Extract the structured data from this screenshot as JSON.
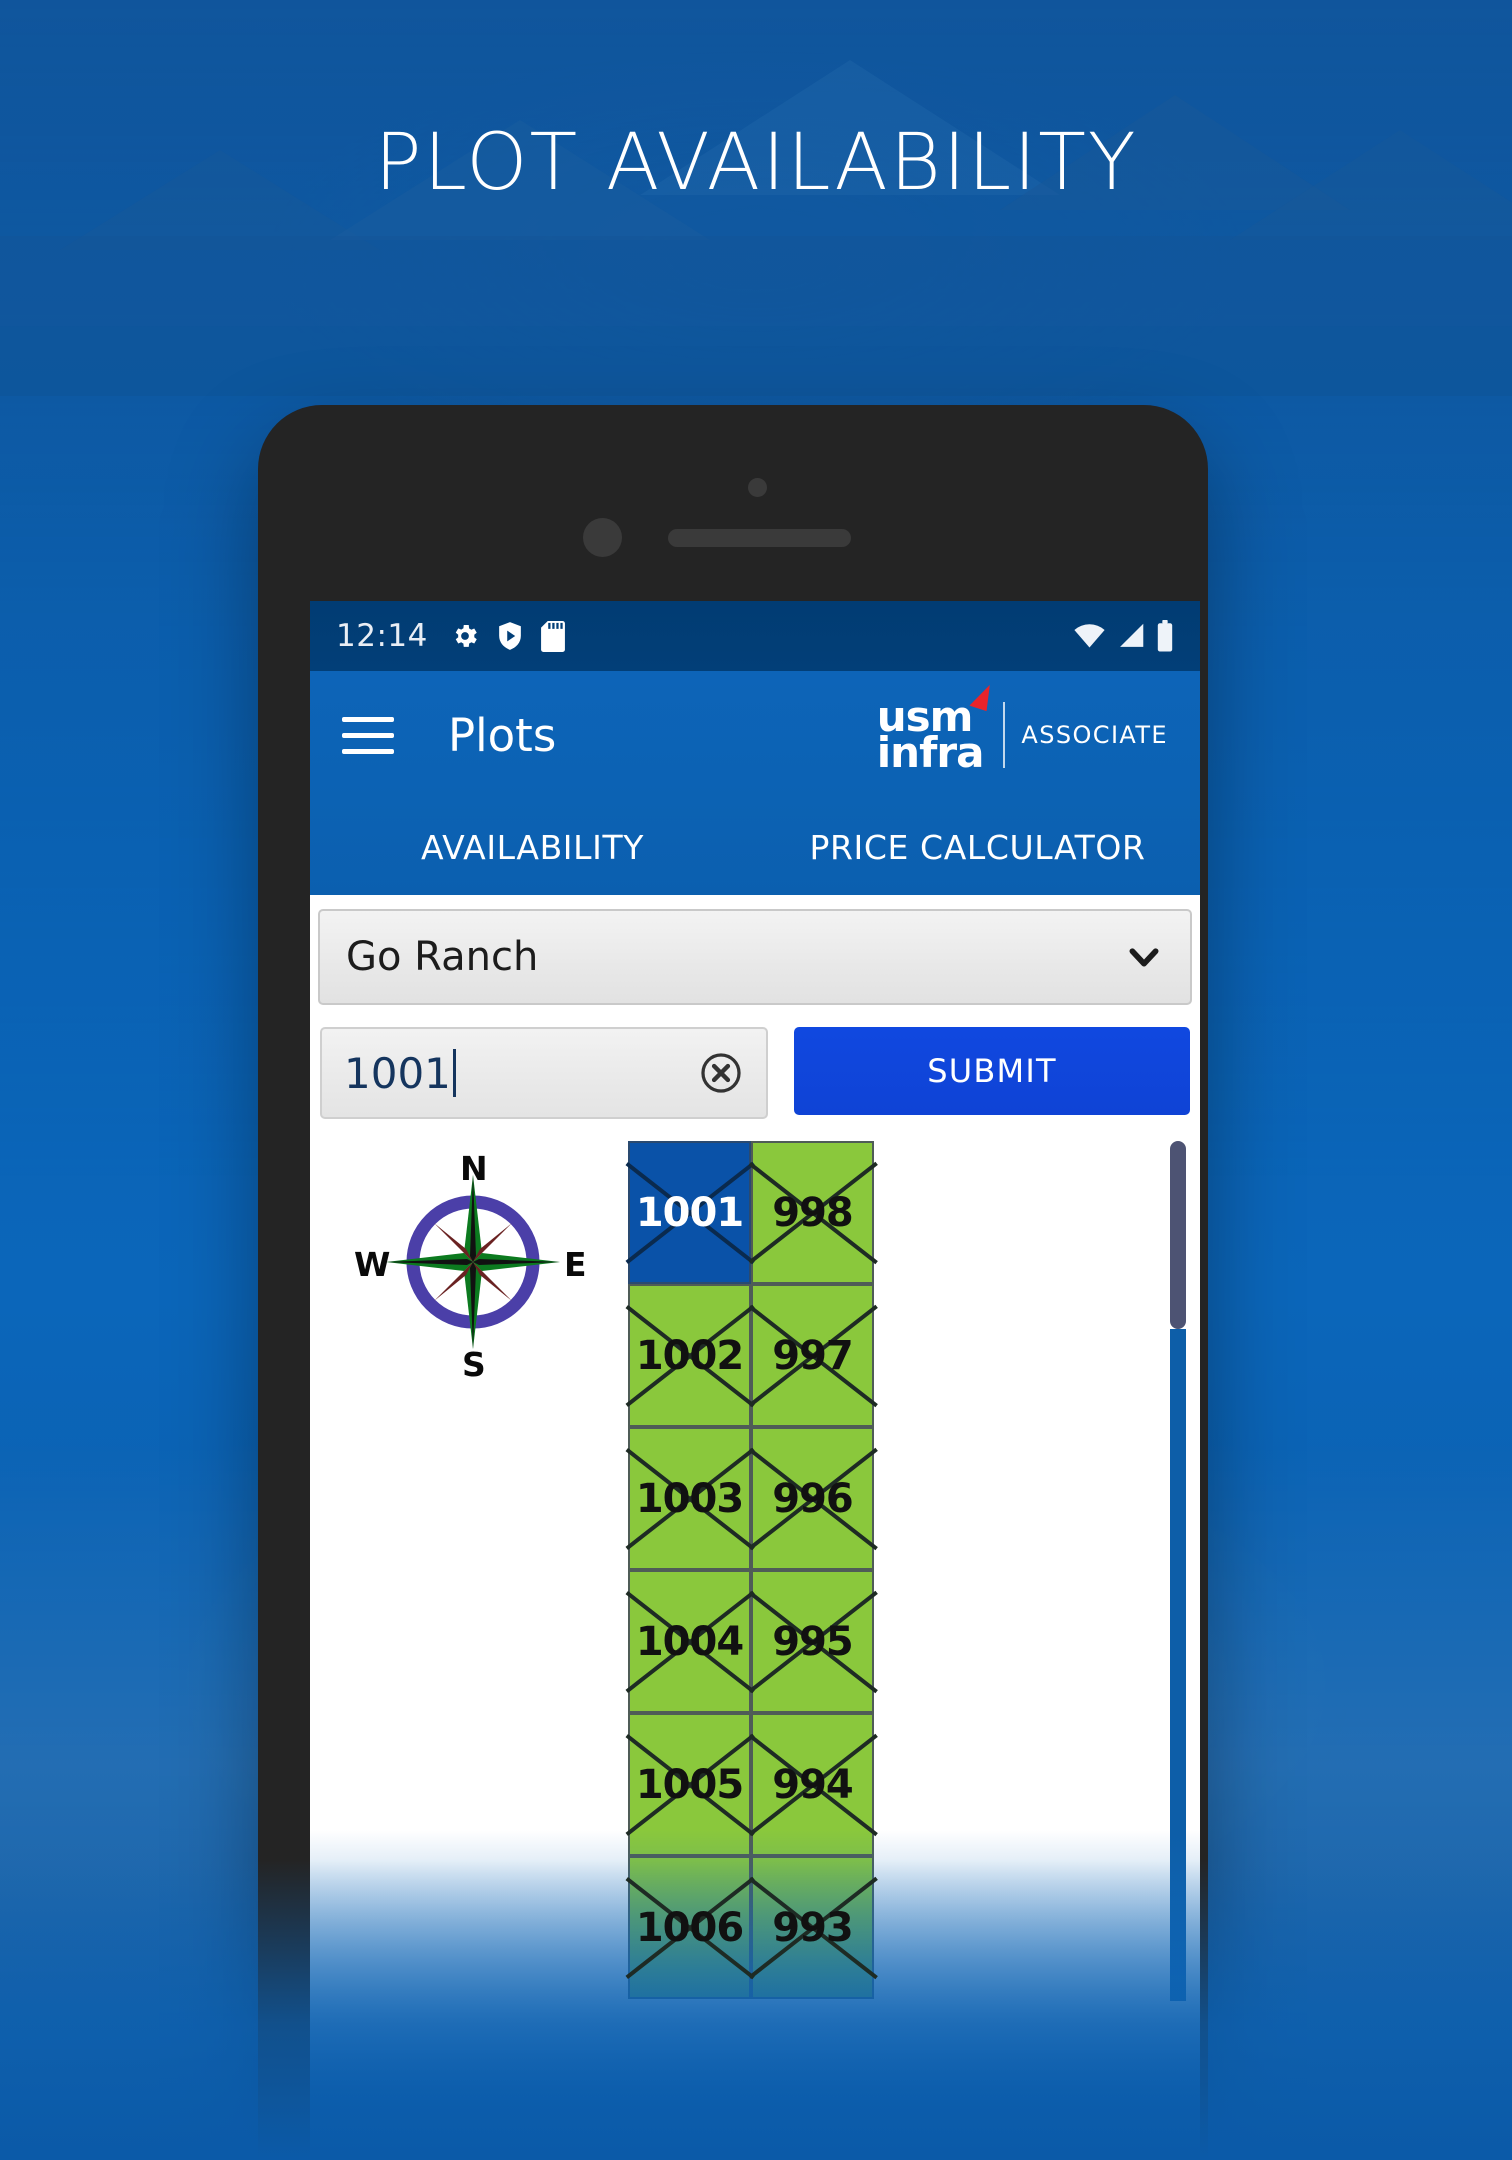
{
  "poster": {
    "title": "PLOT AVAILABILITY",
    "background_color": "#0b62b4",
    "title_color": "#ffffff"
  },
  "statusbar": {
    "time": "12:14",
    "left_icons": [
      "gear-icon",
      "shield-play-icon",
      "sd-card-icon"
    ],
    "right_icons": [
      "wifi-icon",
      "cellular-signal-icon",
      "battery-icon"
    ],
    "background_color": "#023f78"
  },
  "appbar": {
    "menu_icon": "hamburger-menu-icon",
    "title": "Plots",
    "brand": {
      "line1": "usm",
      "line2": "infra",
      "associate": "ASSOCIATE",
      "mark_color": "#e8242a"
    },
    "background_color": "#0c62b3"
  },
  "tabs": [
    {
      "label": "AVAILABILITY",
      "selected": true
    },
    {
      "label": "PRICE CALCULATOR",
      "selected": false
    }
  ],
  "controls": {
    "project_select": {
      "value": "Go Ranch",
      "chevron_icon": "chevron-down-icon"
    },
    "plot_search": {
      "value": "1001",
      "placeholder": "Plot No",
      "clear_icon": "clear-circle-x-icon"
    },
    "submit_label": "SUBMIT",
    "submit_color": "#0f43d5"
  },
  "map": {
    "compass": {
      "north": "N",
      "south": "S",
      "east": "E",
      "west": "W"
    },
    "legend": {
      "available_color": "#8ac83c",
      "selected_color": "#0a52a8"
    },
    "plot_rows": [
      {
        "left": "1001",
        "right": "998",
        "left_selected": true,
        "right_selected": false,
        "faded": false
      },
      {
        "left": "1002",
        "right": "997",
        "left_selected": false,
        "right_selected": false,
        "faded": false
      },
      {
        "left": "1003",
        "right": "996",
        "left_selected": false,
        "right_selected": false,
        "faded": false
      },
      {
        "left": "1004",
        "right": "995",
        "left_selected": false,
        "right_selected": false,
        "faded": false
      },
      {
        "left": "1005",
        "right": "994",
        "left_selected": false,
        "right_selected": false,
        "faded": false
      },
      {
        "left": "1006",
        "right": "993",
        "left_selected": false,
        "right_selected": false,
        "faded": true
      }
    ]
  }
}
